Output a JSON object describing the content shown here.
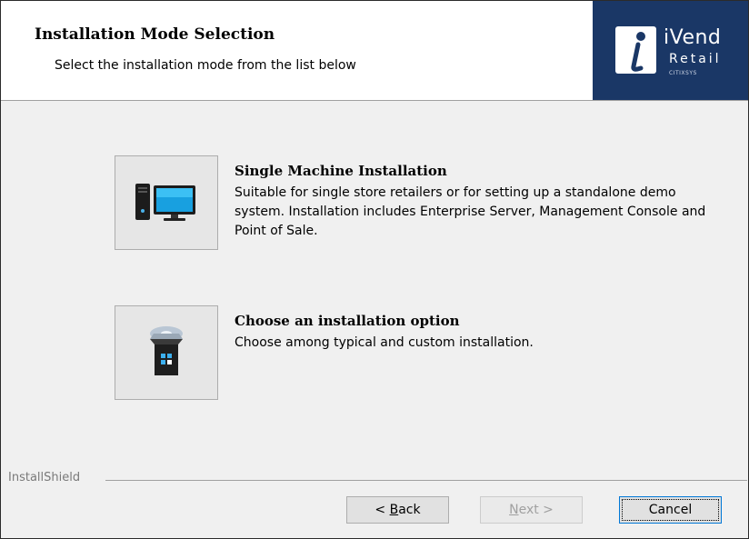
{
  "header": {
    "title": "Installation Mode Selection",
    "subtitle": "Select the installation mode from the list below"
  },
  "logo": {
    "text_main": "iVend",
    "text_sub": "Retail",
    "tagline": "CITIXSYS"
  },
  "options": [
    {
      "title": "Single Machine Installation",
      "description": "Suitable for single store retailers or for setting up a standalone demo system. Installation includes Enterprise Server, Management Console and Point of Sale.",
      "icon": "desktop-computer-icon"
    },
    {
      "title": "Choose an installation option",
      "description": "Choose among typical and custom installation.",
      "icon": "install-box-icon"
    }
  ],
  "footer": {
    "brand": "InstallShield",
    "back_prefix": "< ",
    "back_key": "B",
    "back_rest": "ack",
    "next_key": "N",
    "next_rest": "ext >",
    "cancel": "Cancel"
  },
  "colors": {
    "logo_bg": "#1a3766",
    "accent": "#0078d7"
  }
}
